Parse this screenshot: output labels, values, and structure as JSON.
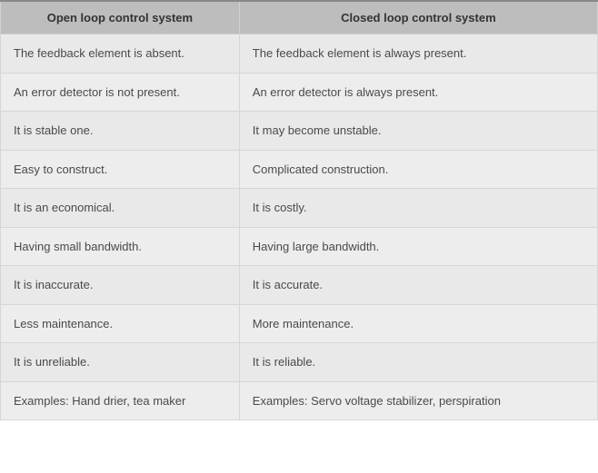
{
  "chart_data": {
    "type": "table",
    "title": "",
    "columns": [
      "Open loop control system",
      "Closed loop control system"
    ],
    "rows": [
      [
        "The feedback element is absent.",
        "The feedback element is always present."
      ],
      [
        "An error detector is not present.",
        "An error detector is always present."
      ],
      [
        "It is stable one.",
        "It may become unstable."
      ],
      [
        "Easy to construct.",
        "Complicated construction."
      ],
      [
        "It is an economical.",
        "It is costly."
      ],
      [
        "Having small bandwidth.",
        "Having large bandwidth."
      ],
      [
        "It is inaccurate.",
        "It is accurate."
      ],
      [
        "Less maintenance.",
        "More maintenance."
      ],
      [
        "It is unreliable.",
        "It is reliable."
      ],
      [
        "Examples: Hand drier, tea maker",
        "Examples: Servo voltage stabilizer, perspiration"
      ]
    ]
  }
}
